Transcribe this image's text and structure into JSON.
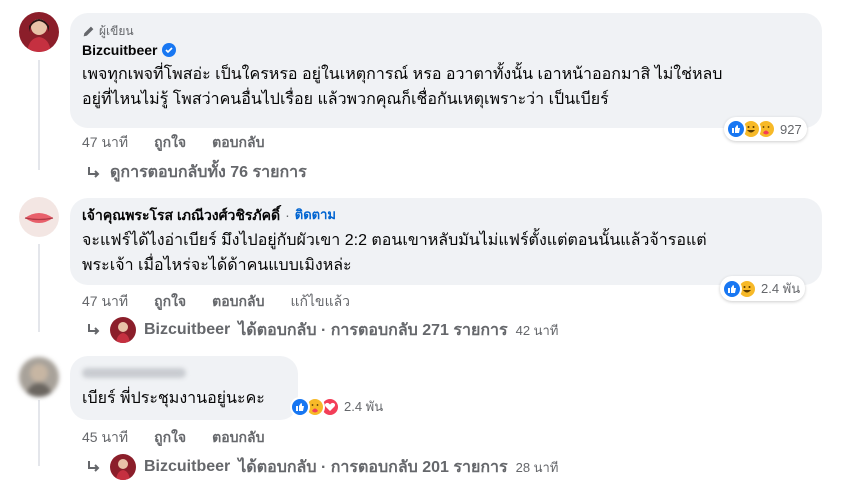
{
  "comments": [
    {
      "author_badge": "ผู้เขียน",
      "author": "Bizcuitbeer",
      "verified": true,
      "text": "เพจทุกเพจที่โพสอ่ะ เป็นใครหรอ อยู่ในเหตุการณ์ หรอ อวาตาทั้งนั้น เอาหน้าออกมาสิ ไม่ใช่หลบ\nอยู่ที่ไหนไม่รู้ โพสว่าคนอื่นไปเรื่อย แล้วพวกคุณก็เชื่อกันเหตุเพราะว่า เป็นเบียร์",
      "reaction_count": "927",
      "reactions": [
        "like",
        "haha",
        "care"
      ],
      "time": "47 นาที",
      "like_label": "ถูกใจ",
      "reply_label": "ตอบกลับ",
      "view_replies": "ดูการตอบกลับทั้ง 76 รายการ"
    },
    {
      "author": "เจ้าคุณพระโรส เภณีวงศ์วชิรภัคดิ์",
      "follow_label": "ติดตาม",
      "text": "จะแฟร์ได้ไงอ่าเบียร์ มึงไปอยู่กับผัวเขา 2:2 ตอนเขาหลับมันไม่แฟร์ตั้งแต่ตอนนั้นแล้วจ้ารอแต่\nพระเจ้า เมื่อไหร่จะได้ด้าคนแบบเมิงหล่ะ",
      "reaction_count": "2.4 พัน",
      "reactions": [
        "like",
        "haha"
      ],
      "time": "47 นาที",
      "like_label": "ถูกใจ",
      "reply_label": "ตอบกลับ",
      "edited_label": "แก้ไขแล้ว",
      "reply_summary": {
        "name": "Bizcuitbeer",
        "text": "ได้ตอบกลับ · การตอบกลับ 271 รายการ",
        "time": "42 นาที"
      }
    },
    {
      "author": "",
      "text": "เบียร์ พี่ประชุมงานอยู่นะคะ",
      "reaction_count": "2.4 พัน",
      "reactions": [
        "like",
        "care",
        "love"
      ],
      "time": "45 นาที",
      "like_label": "ถูกใจ",
      "reply_label": "ตอบกลับ",
      "reply_summary": {
        "name": "Bizcuitbeer",
        "text": "ได้ตอบกลับ · การตอบกลับ 201 รายการ",
        "time": "28 นาที"
      }
    }
  ],
  "icons": {
    "author_badge": "pencil-icon",
    "reply": "reply-arrow-icon",
    "verified": "verified-check-icon"
  },
  "colors": {
    "bubble": "#f0f2f5",
    "meta": "#65676b",
    "link": "#0064d1",
    "like": "#1877f2",
    "haha": "#f7b928",
    "love": "#f33e58"
  }
}
